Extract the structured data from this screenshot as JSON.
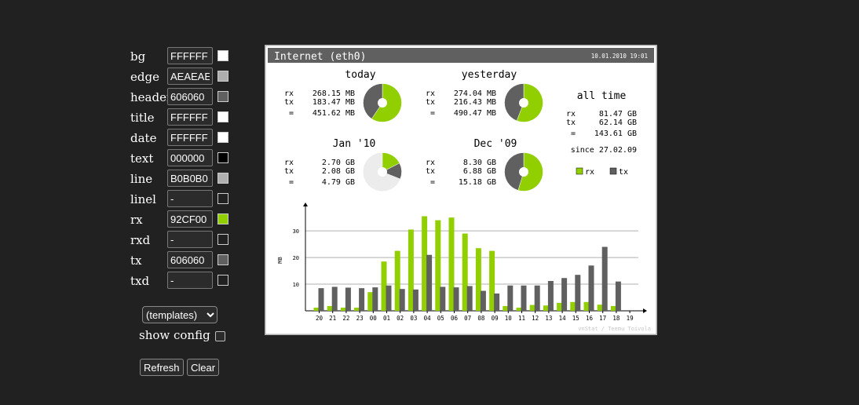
{
  "config": {
    "fields": [
      {
        "label": "bg",
        "value": "FFFFFF",
        "swatch": "#FFFFFF"
      },
      {
        "label": "edge",
        "value": "AEAEAE",
        "swatch": "#AEAEAE"
      },
      {
        "label": "header",
        "value": "606060",
        "swatch": "#606060"
      },
      {
        "label": "title",
        "value": "FFFFFF",
        "swatch": "#FFFFFF"
      },
      {
        "label": "date",
        "value": "FFFFFF",
        "swatch": "#FFFFFF"
      },
      {
        "label": "text",
        "value": "000000",
        "swatch": "#000000"
      },
      {
        "label": "line",
        "value": "B0B0B0",
        "swatch": "#B0B0B0"
      },
      {
        "label": "linel",
        "value": "-",
        "swatch": "transparent"
      },
      {
        "label": "rx",
        "value": "92CF00",
        "swatch": "#92CF00"
      },
      {
        "label": "rxd",
        "value": "-",
        "swatch": "transparent"
      },
      {
        "label": "tx",
        "value": "606060",
        "swatch": "#606060"
      },
      {
        "label": "txd",
        "value": "-",
        "swatch": "transparent"
      }
    ],
    "templates_label": "(templates)",
    "show_config_label": "show config",
    "refresh_label": "Refresh",
    "clear_label": "Clear"
  },
  "graph": {
    "title": "Internet (eth0)",
    "date": "10.01.2010 19:01",
    "colors": {
      "bg": "#FFFFFF",
      "edge": "#AEAEAE",
      "header": "#606060",
      "rx": "#92CF00",
      "tx": "#606060",
      "line": "#B0B0B0"
    },
    "summaries": [
      {
        "title": "today",
        "rx": "268.15 MB",
        "tx": "183.47 MB",
        "total": "451.62 MB",
        "rx_frac": 0.594
      },
      {
        "title": "yesterday",
        "rx": "274.04 MB",
        "tx": "216.43 MB",
        "total": "490.47 MB",
        "rx_frac": 0.559
      },
      {
        "title": "Jan '10",
        "rx": "2.70 GB",
        "tx": "2.08 GB",
        "total": "4.79 GB",
        "rx_frac": 0.564,
        "month_frac": 0.31
      },
      {
        "title": "Dec '09",
        "rx": "8.30 GB",
        "tx": "6.88 GB",
        "total": "15.18 GB",
        "rx_frac": 0.547
      }
    ],
    "alltime": {
      "title": "all time",
      "rx": "81.47 GB",
      "tx": "62.14 GB",
      "total": "143.61 GB",
      "since": "since 27.02.09"
    },
    "labels": {
      "rx": "rx",
      "tx": "tx",
      "eq": "=",
      "legend_rx": "rx",
      "legend_tx": "tx"
    },
    "footer": "vnStat / Teemu Toivola"
  },
  "chart_data": {
    "type": "bar",
    "ylabel": "MB",
    "ylim": [
      0,
      38
    ],
    "yticks": [
      10,
      20,
      30
    ],
    "categories": [
      "20",
      "21",
      "22",
      "23",
      "00",
      "01",
      "02",
      "03",
      "04",
      "05",
      "06",
      "07",
      "08",
      "09",
      "10",
      "11",
      "12",
      "13",
      "14",
      "15",
      "16",
      "17",
      "18",
      "19"
    ],
    "series": [
      {
        "name": "rx",
        "values": [
          1.2,
          1.8,
          1.2,
          1.2,
          7.0,
          18.5,
          22.5,
          30.5,
          35.5,
          34.0,
          35.0,
          29.0,
          23.5,
          22.5,
          1.8,
          1.2,
          2.2,
          2.0,
          3.0,
          3.3,
          3.3,
          2.3,
          1.8,
          0
        ]
      },
      {
        "name": "tx",
        "values": [
          8.5,
          9.0,
          8.7,
          8.5,
          8.8,
          9.5,
          8.2,
          8.0,
          21.0,
          9.0,
          8.8,
          9.3,
          7.5,
          6.5,
          9.5,
          9.5,
          9.5,
          11.2,
          12.3,
          13.5,
          17.0,
          24.0,
          11.0,
          0
        ]
      }
    ]
  }
}
